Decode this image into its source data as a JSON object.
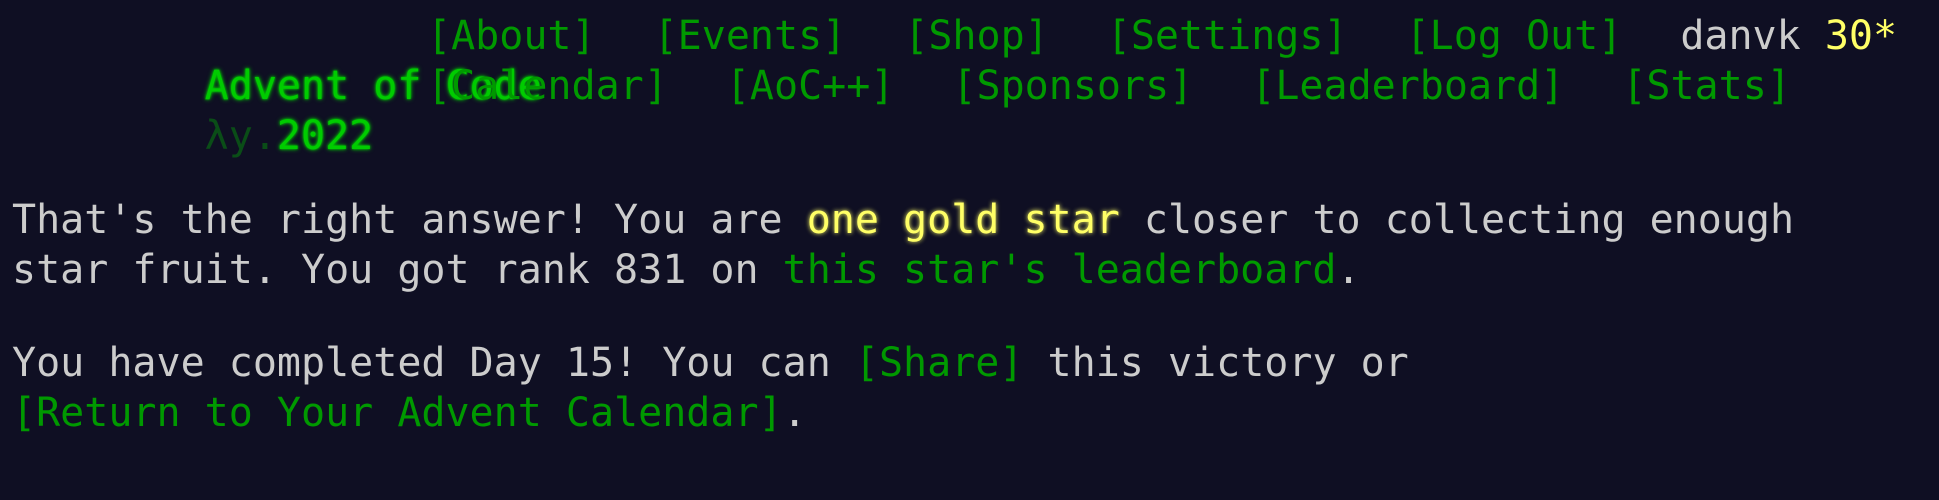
{
  "header": {
    "title": "Advent of Code",
    "year_prefix": "λy.",
    "year": "2022",
    "nav_top": [
      "[About]",
      "[Events]",
      "[Shop]",
      "[Settings]",
      "[Log Out]"
    ],
    "nav_bottom": [
      "[Calendar]",
      "[AoC++]",
      "[Sponsors]",
      "[Leaderboard]",
      "[Stats]"
    ],
    "user": {
      "name": "danvk",
      "stars": "30*"
    }
  },
  "main": {
    "p1": {
      "before": "That's the right answer! You are ",
      "highlight": "one gold star",
      "middle": " closer to collecting enough star fruit. You got rank 831 on ",
      "link": "this star's leaderboard",
      "after": "."
    },
    "p2": {
      "before": "You have completed Day 15! You can ",
      "share_link": "[Share]",
      "middle": " this victory or ",
      "return_link": "[Return to Your Advent Calendar]",
      "after": "."
    }
  },
  "colors": {
    "background": "#0f0f23",
    "text": "#cccccc",
    "title_green": "#00cc00",
    "link_green": "#009900",
    "gold": "#ffff66"
  }
}
